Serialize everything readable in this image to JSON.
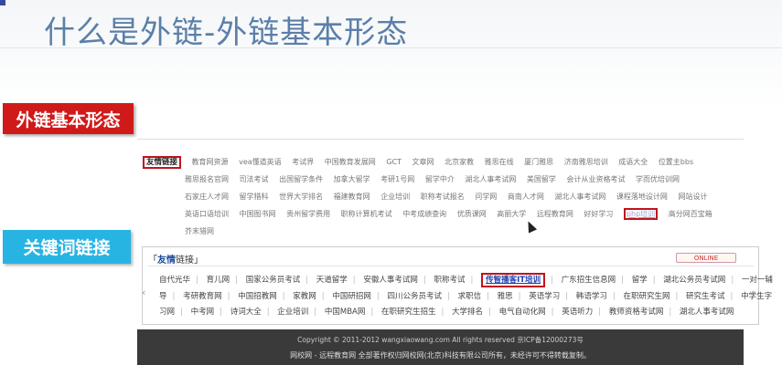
{
  "slide": {
    "title": "什么是外链-外链基本形态",
    "label_basic": "外链基本形态",
    "label_keyword": "关键词链接"
  },
  "shot1": {
    "heading": "友情链接",
    "rows": [
      [
        "教育网资源",
        "vea懂道英语",
        "考试界",
        "中国教育发展网",
        "GCT",
        "文章网",
        "北京家教",
        "雅思在线",
        "厦门雅思",
        "济南雅思培训",
        "成语大全",
        "位置主bbs"
      ],
      [
        "雅思报名官网",
        "司法考试",
        "出国留学条件",
        "加拿大留学",
        "考研1号网",
        "留学中介",
        "湖北人事考试网",
        "美国留学",
        "会计从业资格考试",
        "学而优培训网"
      ],
      [
        "石家庄人才网",
        "留学猎科",
        "世界大学排名",
        "福建教育网",
        "企业培训",
        "职称考试报名",
        "问学网",
        "商南人才网",
        "湖北人事考试网",
        "课程落地设计网",
        "网站设计"
      ],
      [
        "英语口语培训",
        "中国图书网",
        "贵州留学费用",
        "职称计算机考试",
        "中考成绩查询",
        "优质课网",
        "高丽大学",
        "远程教育网",
        "好好学习",
        "php培训",
        "高分网百宝箱"
      ],
      [
        "芥末猎网"
      ]
    ],
    "highlighted": "php培训"
  },
  "shot2": {
    "heading_prefix": "友情",
    "heading_suffix": "链接",
    "online_badge": "ONLINE",
    "rows": [
      [
        "自代光华",
        "育儿网",
        "国家公务员考试",
        "天道留学",
        "安徽人事考试网",
        "职称考试",
        "传智播客IT培训",
        "广东招生信息网",
        "留学",
        "湖北公务员考试网",
        "一对一辅"
      ],
      [
        "导",
        "考研教育网",
        "中国招教网",
        "家教网",
        "中国研招网",
        "四川公务员考试",
        "求职信",
        "雅思",
        "英语学习",
        "韩语学习",
        "在职研究生网",
        "研究生考试",
        "中学生字"
      ],
      [
        "习网",
        "中考网",
        "诗词大全",
        "企业培训",
        "中国MBA网",
        "在职研究生招生",
        "大学排名",
        "电气自动化网",
        "英语听力",
        "教师资格考试网",
        "湖北人事考试网"
      ]
    ],
    "highlighted": "传智播客IT培训"
  },
  "footer": {
    "line1": "Copyright © 2011-2012 wangxiaowang.com All rights reserved 京ICP备12000273号",
    "line2": "网校网 - 远程教育网 全部著作权归网校网(北京)科技有限公司所有，未经许可不得转载复制。"
  }
}
